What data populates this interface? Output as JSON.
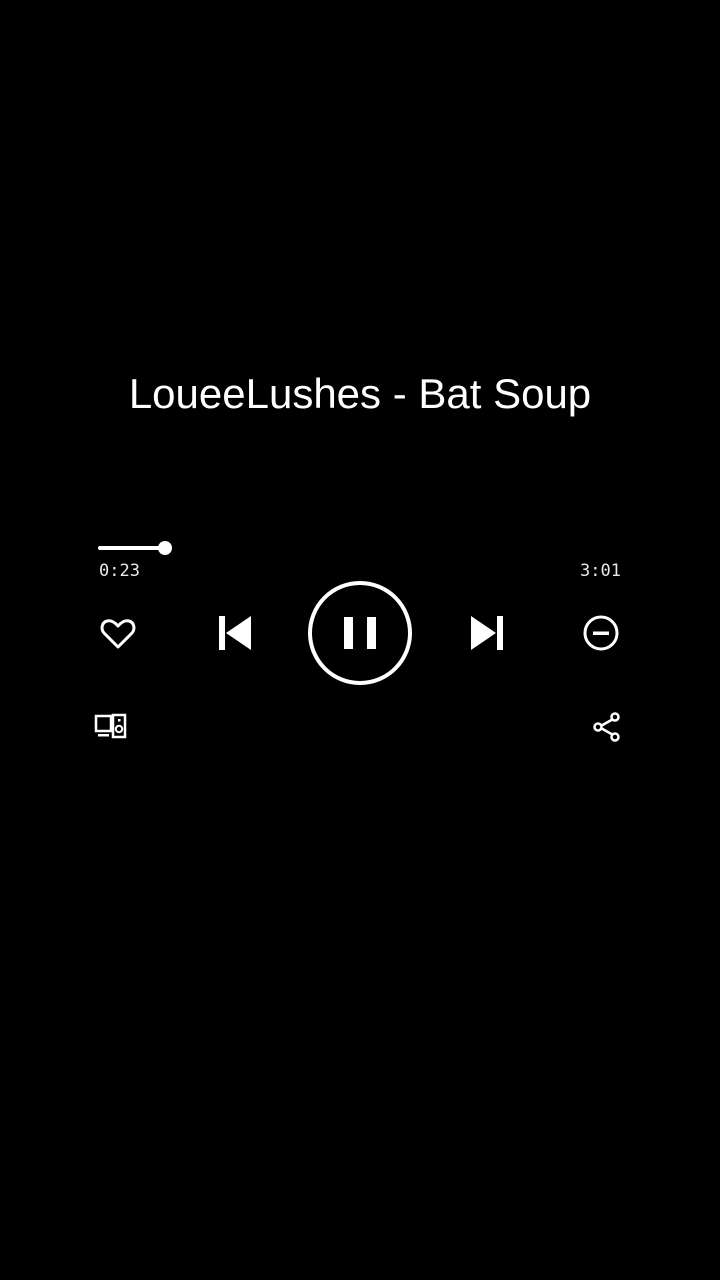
{
  "player": {
    "track_title": "LoueeLushes - Bat Soup",
    "elapsed": "0:23",
    "duration": "3:01",
    "progress_fraction": 0.127
  },
  "icons": {
    "like": "heart-icon",
    "previous": "skip-previous-icon",
    "play_pause": "pause-icon",
    "next": "skip-next-icon",
    "hide": "minus-circle-icon",
    "devices": "connect-device-icon",
    "share": "share-icon"
  },
  "colors": {
    "background": "#000000",
    "foreground": "#ffffff"
  }
}
